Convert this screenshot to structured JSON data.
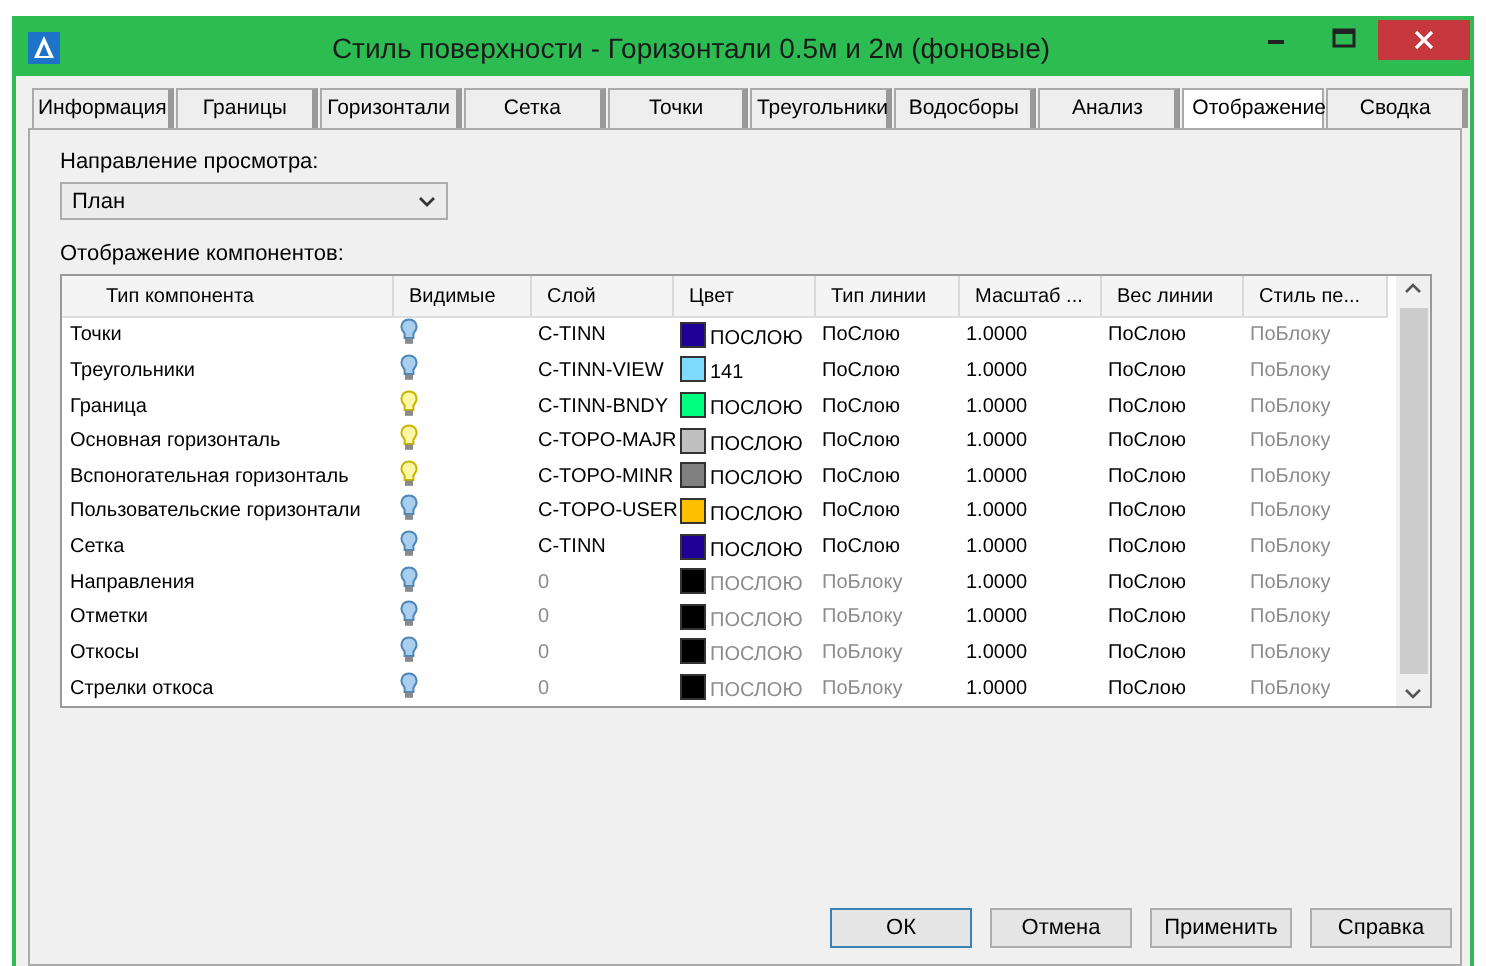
{
  "window": {
    "title": "Стиль поверхности - Горизонтали 0.5м и 2м (фоновые)"
  },
  "tabs": [
    {
      "label": "Информация",
      "selected": false
    },
    {
      "label": "Границы",
      "selected": false
    },
    {
      "label": "Горизонтали",
      "selected": false
    },
    {
      "label": "Сетка",
      "selected": false
    },
    {
      "label": "Точки",
      "selected": false
    },
    {
      "label": "Треугольники",
      "selected": false
    },
    {
      "label": "Водосборы",
      "selected": false
    },
    {
      "label": "Анализ",
      "selected": false
    },
    {
      "label": "Отображение",
      "selected": true
    },
    {
      "label": "Сводка",
      "selected": false
    }
  ],
  "view_direction": {
    "label": "Направление просмотра:",
    "value": "План"
  },
  "components": {
    "label": "Отображение компонентов:",
    "columns": [
      "Тип компонента",
      "Видимые",
      "Слой",
      "Цвет",
      "Тип линии",
      "Масштаб ...",
      "Вес линии",
      "Стиль пе..."
    ],
    "rows": [
      {
        "name": "Точки",
        "visible": false,
        "layer": "C-TINN",
        "color": "#1f0096",
        "color_text": "ПОСЛОЮ",
        "linetype": "ПоСлою",
        "scale": "1.0000",
        "lineweight": "ПоСлою",
        "plot_style": "ПоБлоку",
        "by_block": false
      },
      {
        "name": "Треугольники",
        "visible": false,
        "layer": "C-TINN-VIEW",
        "color": "#7fd9ff",
        "color_text": "141",
        "linetype": "ПоСлою",
        "scale": "1.0000",
        "lineweight": "ПоСлою",
        "plot_style": "ПоБлоку",
        "by_block": false
      },
      {
        "name": "Граница",
        "visible": true,
        "layer": "C-TINN-BNDY",
        "color": "#00ff7f",
        "color_text": "ПОСЛОЮ",
        "linetype": "ПоСлою",
        "scale": "1.0000",
        "lineweight": "ПоСлою",
        "plot_style": "ПоБлоку",
        "by_block": false
      },
      {
        "name": "Основная горизонталь",
        "visible": true,
        "layer": "C-TOPO-MAJR",
        "color": "#c0c0c0",
        "color_text": "ПОСЛОЮ",
        "linetype": "ПоСлою",
        "scale": "1.0000",
        "lineweight": "ПоСлою",
        "plot_style": "ПоБлоку",
        "by_block": false
      },
      {
        "name": "Вспоногательная горизонталь",
        "visible": true,
        "layer": "C-TOPO-MINR",
        "color": "#808080",
        "color_text": "ПОСЛОЮ",
        "linetype": "ПоСлою",
        "scale": "1.0000",
        "lineweight": "ПоСлою",
        "plot_style": "ПоБлоку",
        "by_block": false
      },
      {
        "name": "Пользовательские горизонтали",
        "visible": false,
        "layer": "C-TOPO-USER",
        "color": "#ffbf00",
        "color_text": "ПОСЛОЮ",
        "linetype": "ПоСлою",
        "scale": "1.0000",
        "lineweight": "ПоСлою",
        "plot_style": "ПоБлоку",
        "by_block": false
      },
      {
        "name": "Сетка",
        "visible": false,
        "layer": "C-TINN",
        "color": "#1f0096",
        "color_text": "ПОСЛОЮ",
        "linetype": "ПоСлою",
        "scale": "1.0000",
        "lineweight": "ПоСлою",
        "plot_style": "ПоБлоку",
        "by_block": false
      },
      {
        "name": "Направления",
        "visible": false,
        "layer": "0",
        "color": "#000000",
        "color_text": "ПОСЛОЮ",
        "linetype": "ПоБлоку",
        "scale": "1.0000",
        "lineweight": "ПоСлою",
        "plot_style": "ПоБлоку",
        "by_block": true
      },
      {
        "name": "Отметки",
        "visible": false,
        "layer": "0",
        "color": "#000000",
        "color_text": "ПОСЛОЮ",
        "linetype": "ПоБлоку",
        "scale": "1.0000",
        "lineweight": "ПоСлою",
        "plot_style": "ПоБлоку",
        "by_block": true
      },
      {
        "name": "Откосы",
        "visible": false,
        "layer": "0",
        "color": "#000000",
        "color_text": "ПОСЛОЮ",
        "linetype": "ПоБлоку",
        "scale": "1.0000",
        "lineweight": "ПоСлою",
        "plot_style": "ПоБлоку",
        "by_block": true
      },
      {
        "name": "Стрелки откоса",
        "visible": false,
        "layer": "0",
        "color": "#000000",
        "color_text": "ПОСЛОЮ",
        "linetype": "ПоБлоку",
        "scale": "1.0000",
        "lineweight": "ПоСлою",
        "plot_style": "ПоБлоку",
        "by_block": true
      }
    ]
  },
  "buttons": [
    "ОК",
    "Отмена",
    "Применить",
    "Справка"
  ]
}
